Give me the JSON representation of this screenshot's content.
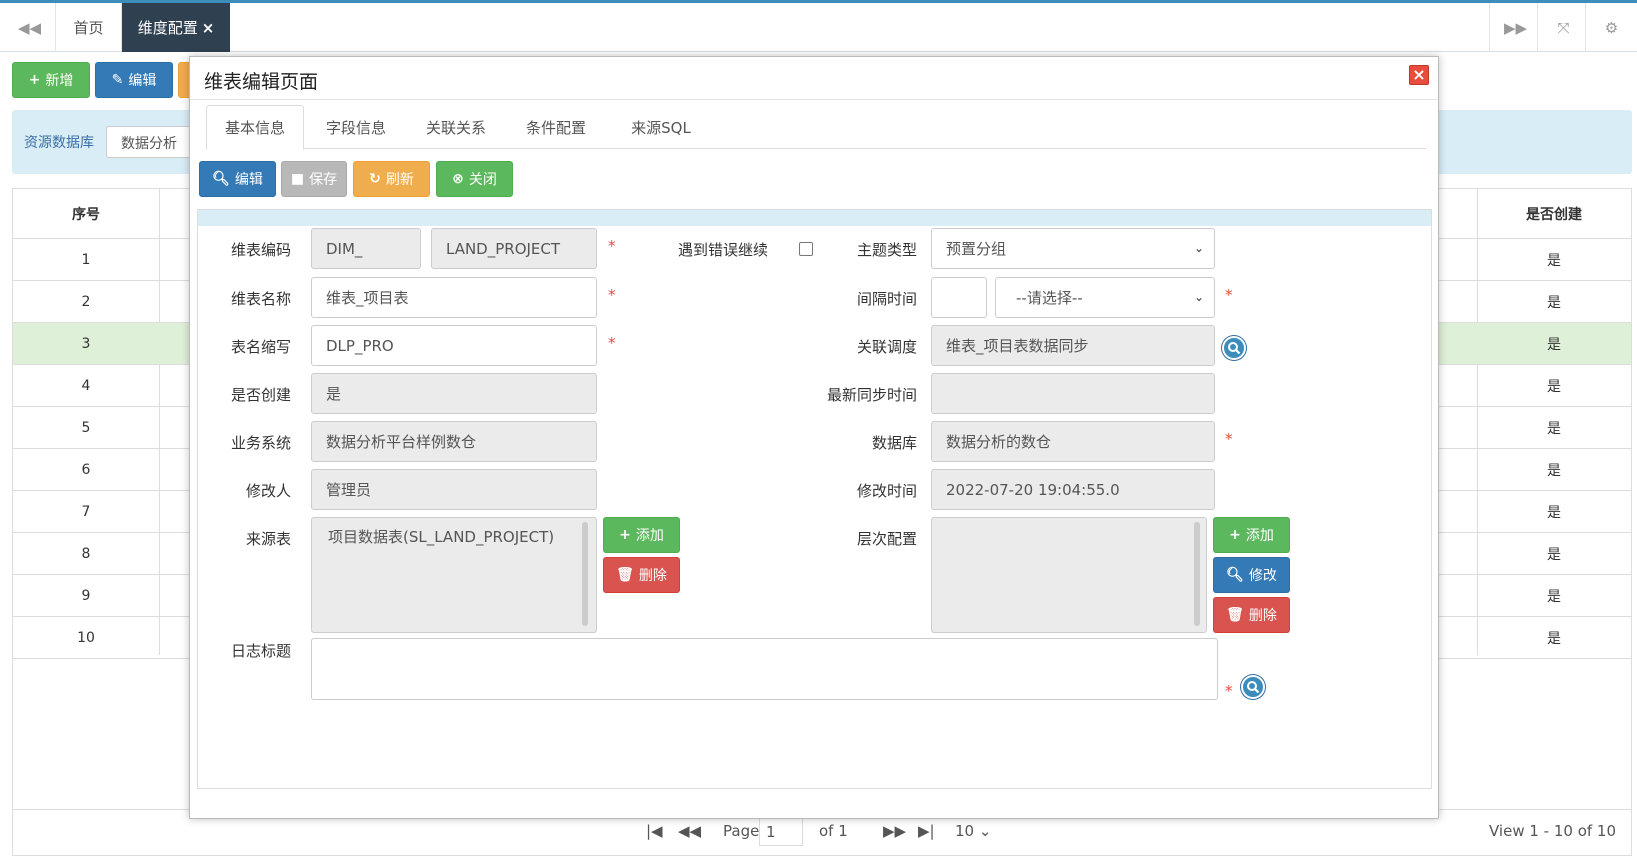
{
  "topbar": {
    "home_tab": "首页",
    "active_tab": "维度配置",
    "active_tab_close": "×",
    "icons": [
      "double-left-icon",
      "double-right-icon",
      "fullscreen-icon",
      "gear-icon"
    ]
  },
  "toolbar": {
    "add_label": "新增",
    "edit_label": "编辑"
  },
  "search": {
    "db_label": "资源数据库",
    "db_value": "数据分析"
  },
  "grid": {
    "columns": [
      "序号",
      "是否创建"
    ],
    "rows": [
      {
        "no": "1",
        "created": "是"
      },
      {
        "no": "2",
        "created": "是"
      },
      {
        "no": "3",
        "created": "是"
      },
      {
        "no": "4",
        "created": "是"
      },
      {
        "no": "5",
        "created": "是"
      },
      {
        "no": "6",
        "created": "是"
      },
      {
        "no": "7",
        "created": "是"
      },
      {
        "no": "8",
        "created": "是"
      },
      {
        "no": "9",
        "created": "是"
      },
      {
        "no": "10",
        "created": "是"
      }
    ],
    "selected_row": 3
  },
  "pager": {
    "page_label": "Page",
    "page_value": "1",
    "of_label": "of 1",
    "page_size": "10",
    "view_text": "View 1 - 10 of 10"
  },
  "modal": {
    "title": "维表编辑页面",
    "close_label": "×",
    "tabs": [
      "基本信息",
      "字段信息",
      "关联关系",
      "条件配置",
      "来源SQL"
    ],
    "active_tab": 0,
    "buttons": {
      "edit": "编辑",
      "save": "保存",
      "refresh": "刷新",
      "close": "关闭"
    },
    "form": {
      "code_label": "维表编码",
      "code_prefix": "DIM_",
      "code_value": "LAND_PROJECT",
      "continue_on_error_label": "遇到错误继续",
      "subject_type_label": "主题类型",
      "subject_type_value": "预置分组",
      "name_label": "维表名称",
      "name_value": "维表_项目表",
      "interval_label": "间隔时间",
      "interval_value": "",
      "interval_unit": "--请选择--",
      "abbr_label": "表名缩写",
      "abbr_value": "DLP_PRO",
      "schedule_label": "关联调度",
      "schedule_value": "维表_项目表数据同步",
      "created_label": "是否创建",
      "created_value": "是",
      "last_sync_label": "最新同步时间",
      "last_sync_value": "",
      "biz_system_label": "业务系统",
      "biz_system_value": "数据分析平台样例数仓",
      "database_label": "数据库",
      "database_value": "数据分析的数仓",
      "modifier_label": "修改人",
      "modifier_value": "管理员",
      "modified_time_label": "修改时间",
      "modified_time_value": "2022-07-20 19:04:55.0",
      "source_table_label": "来源表",
      "source_table_value": "项目数据表(SL_LAND_PROJECT)",
      "level_config_label": "层次配置",
      "log_title_label": "日志标题",
      "add_label": "添加",
      "delete_label": "删除",
      "modify_label": "修改",
      "required_mark": "*"
    }
  }
}
